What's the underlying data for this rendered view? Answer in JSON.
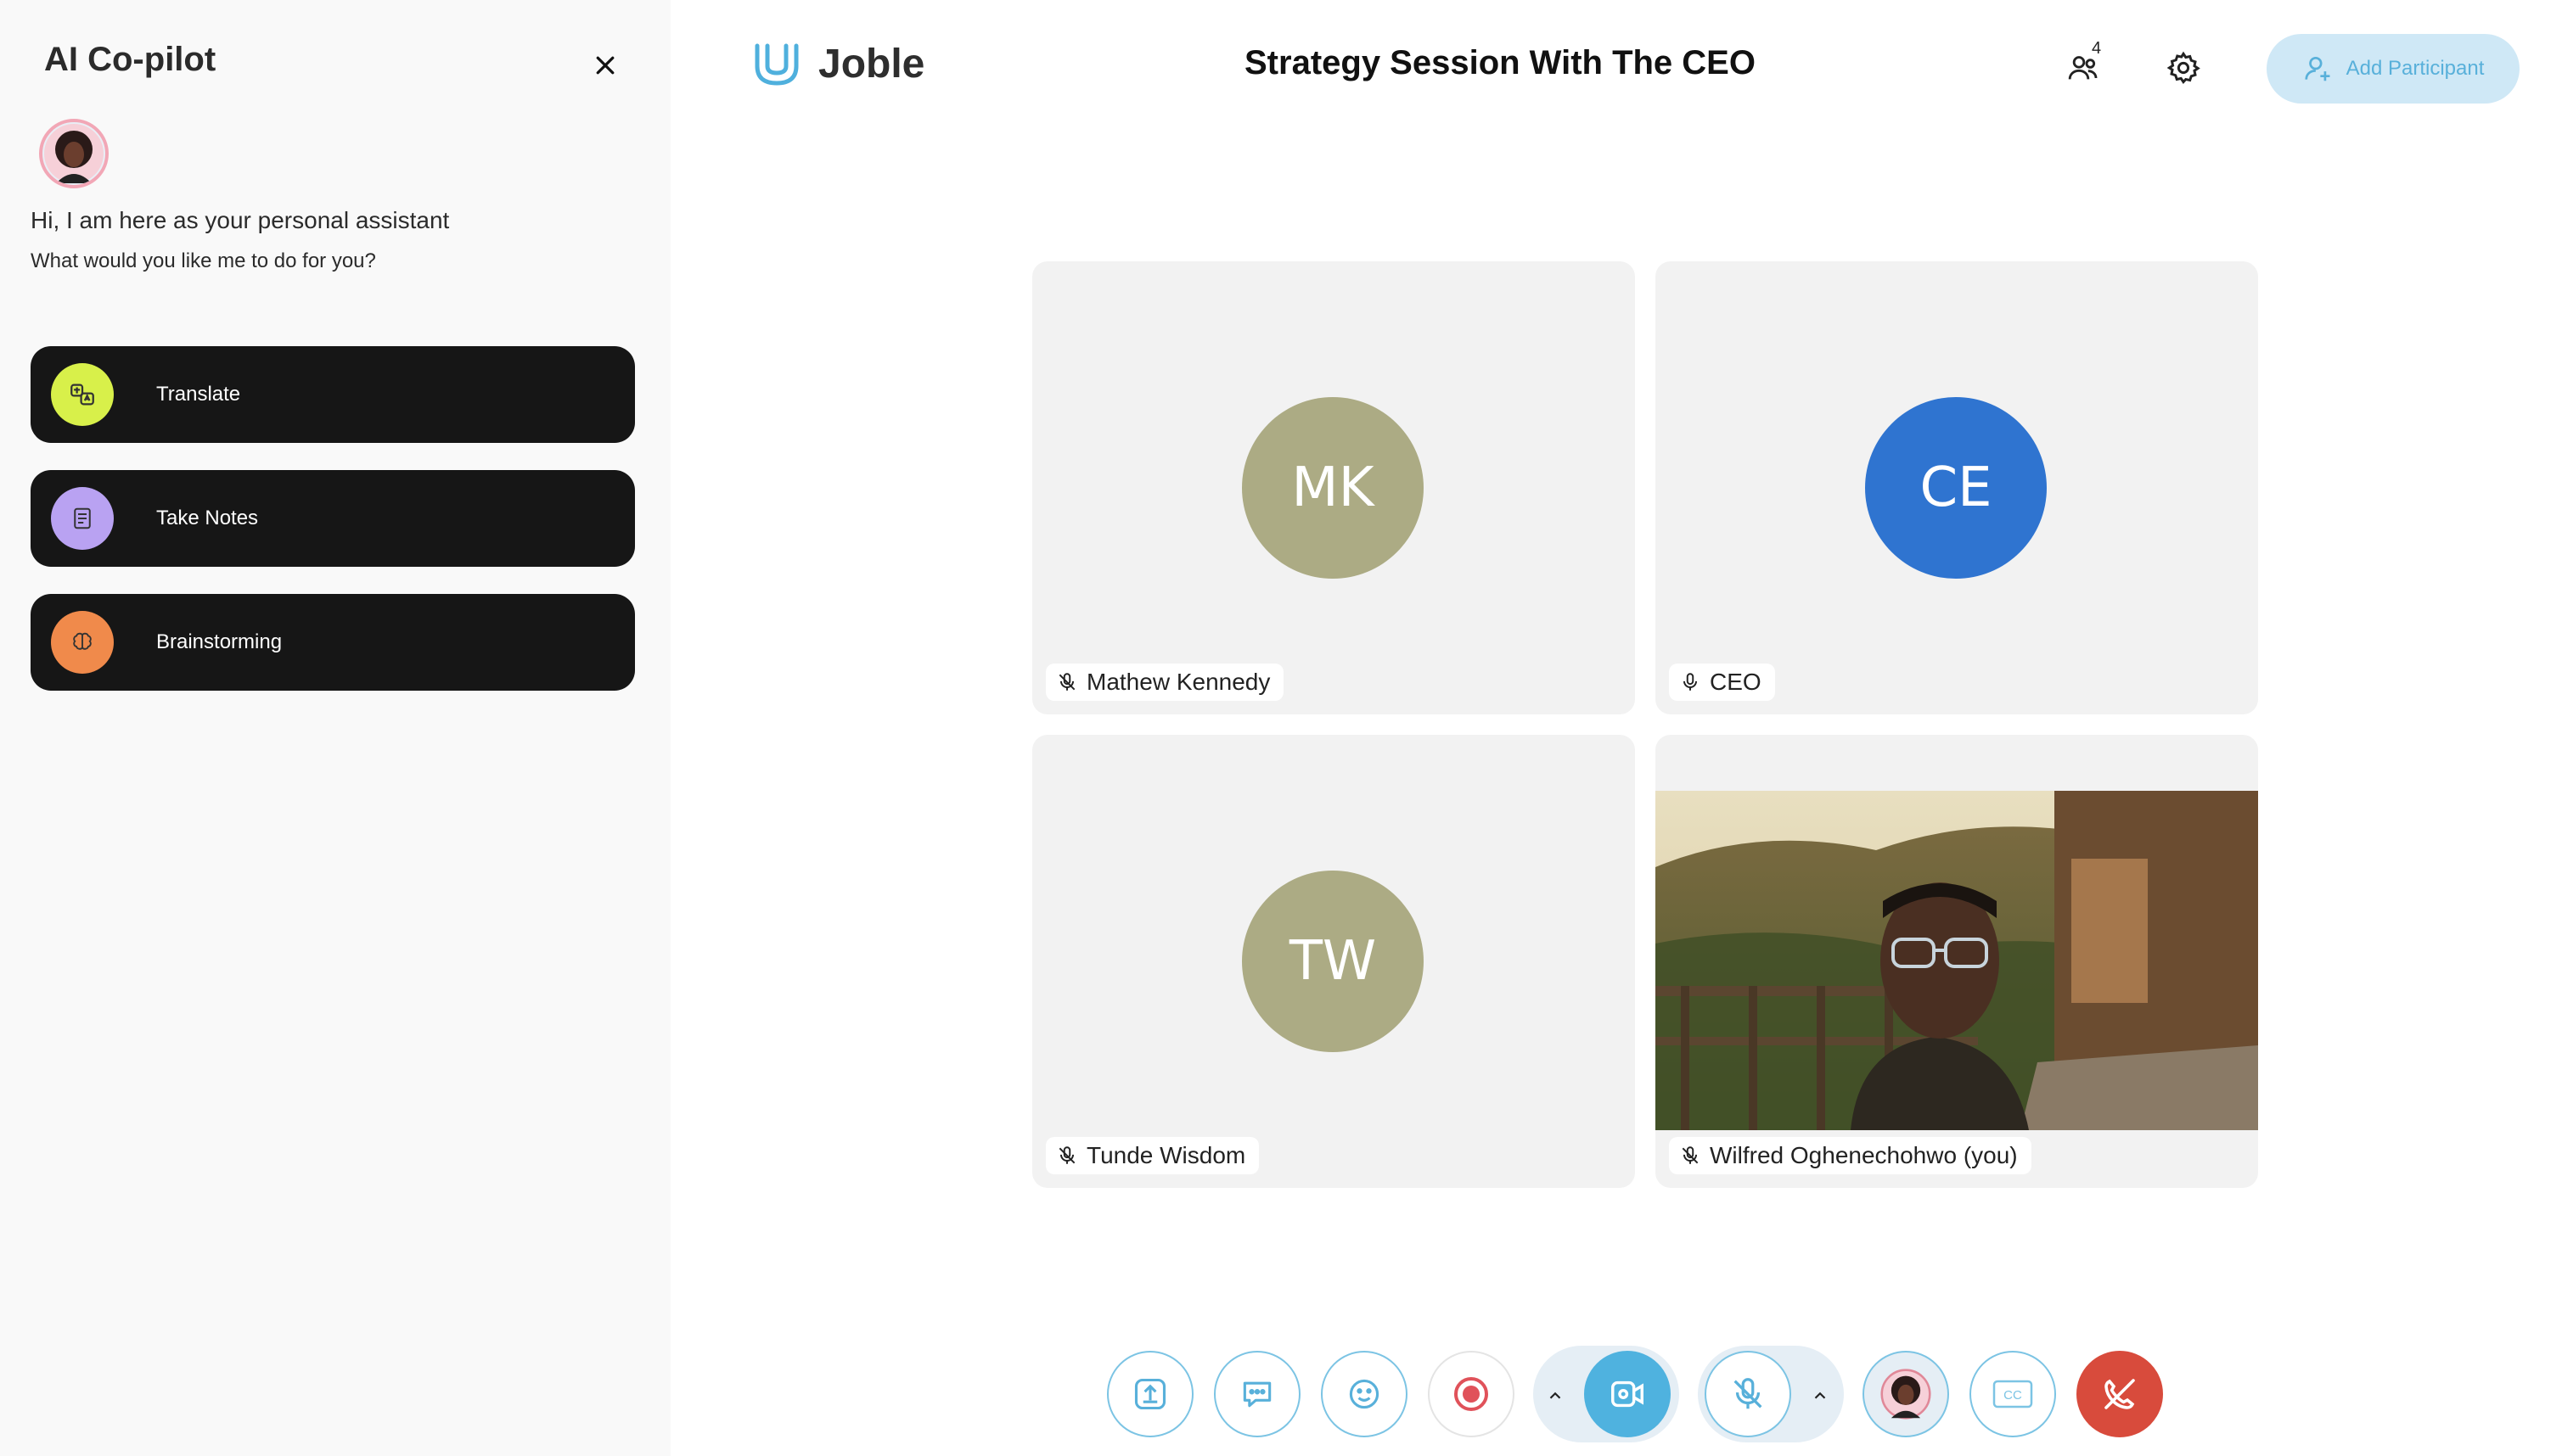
{
  "sidebar": {
    "title": "AI Co-pilot",
    "greeting": "Hi, I am here as your personal assistant",
    "subtitle": "What would you like me to do for you?",
    "actions": [
      {
        "label": "Translate",
        "icon": "translate-icon",
        "color": "#d8f04a"
      },
      {
        "label": "Take Notes",
        "icon": "notes-icon",
        "color": "#b9a2f2"
      },
      {
        "label": "Brainstorming",
        "icon": "brain-icon",
        "color": "#f08a4b"
      }
    ]
  },
  "header": {
    "app_name": "Joble",
    "meeting_title": "Strategy Session With The CEO",
    "participant_count": "4",
    "add_participant_label": "Add Participant"
  },
  "participants": [
    {
      "initials": "MK",
      "name": "Mathew Kennedy",
      "avatar_color": "#acab84",
      "mic": "muted"
    },
    {
      "initials": "CE",
      "name": "CEO",
      "avatar_color": "#2f74d0",
      "mic": "on"
    },
    {
      "initials": "TW",
      "name": "Tunde Wisdom",
      "avatar_color": "#acab84",
      "mic": "muted"
    },
    {
      "initials": "",
      "name": "Wilfred Oghenechohwo (you)",
      "avatar_color": "",
      "mic": "muted",
      "video": true
    }
  ],
  "toolbar": {
    "buttons": [
      "share-screen-icon",
      "chat-icon",
      "emoji-icon",
      "record-icon",
      "camera-icon",
      "mic-muted-icon",
      "ai-avatar-icon",
      "captions-icon",
      "end-call-icon"
    ],
    "captions_label": "CC"
  },
  "colors": {
    "accent": "#58b0da",
    "end_call": "#d84b3c",
    "record": "#e0525a"
  }
}
